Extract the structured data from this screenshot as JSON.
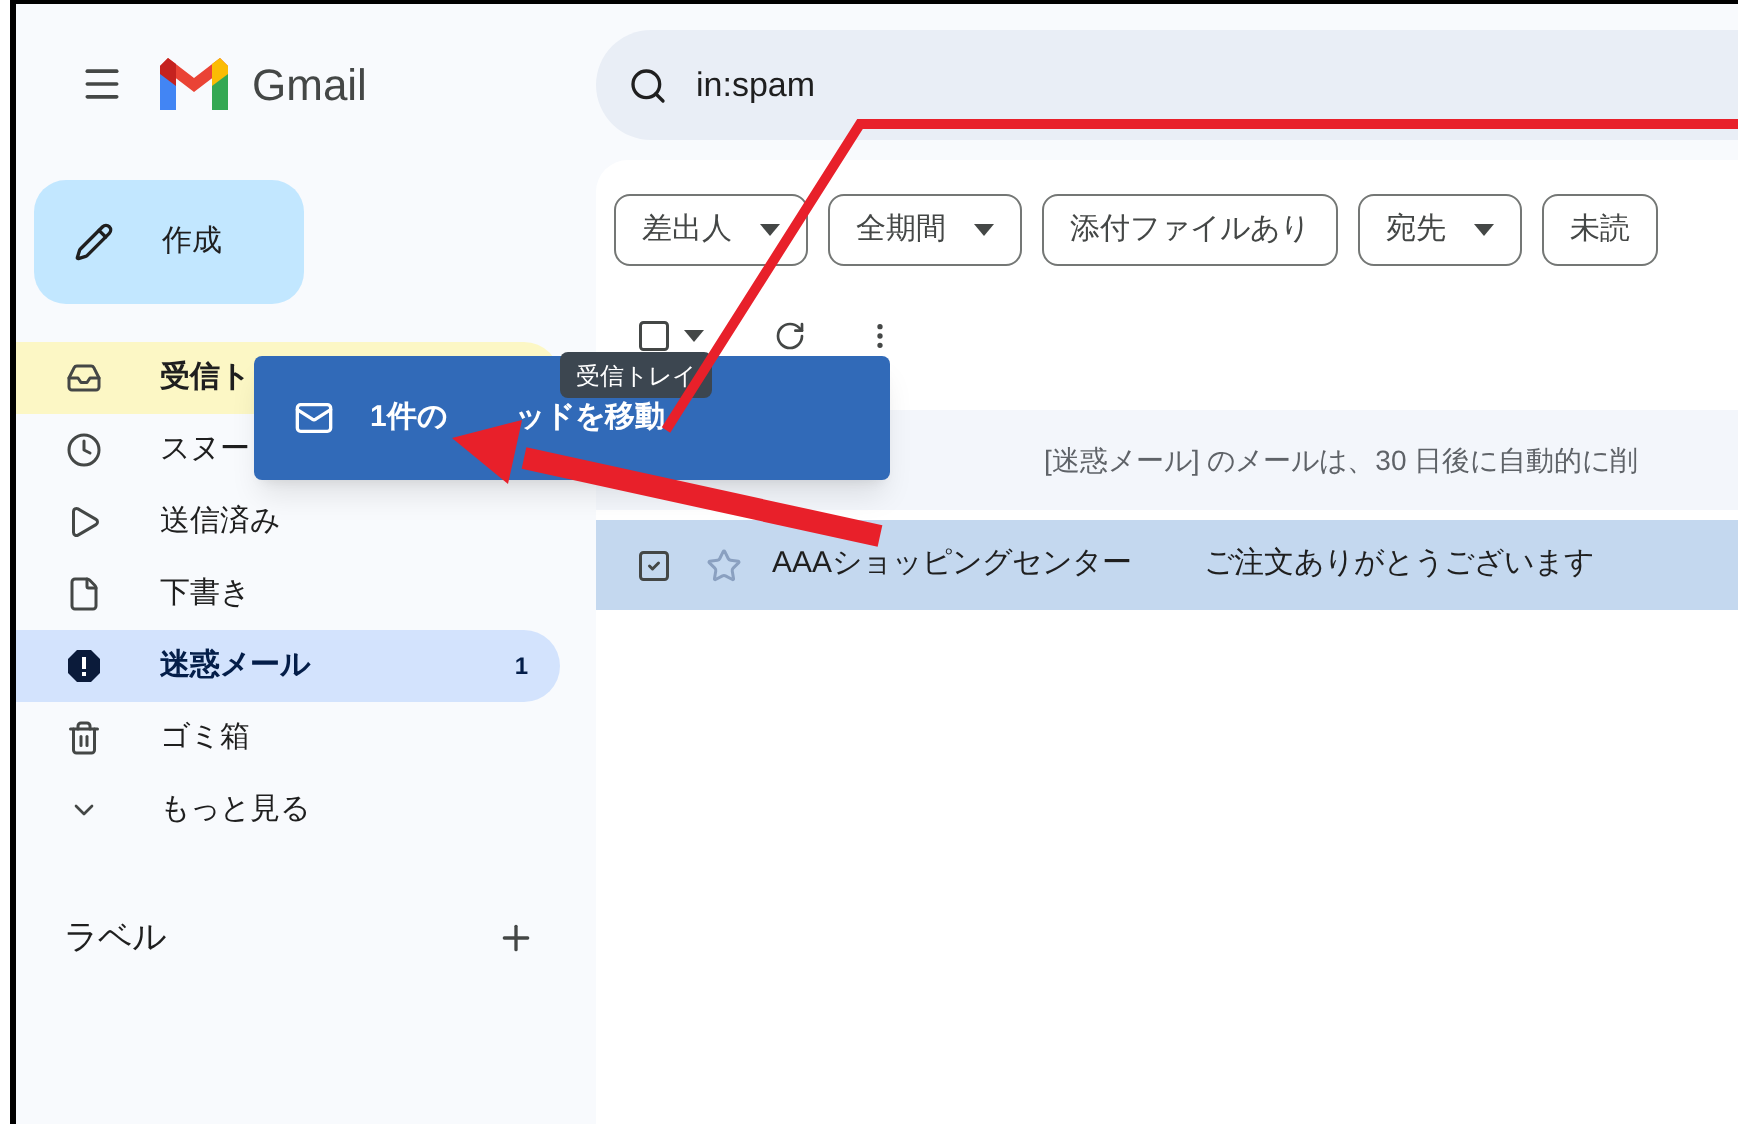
{
  "header": {
    "app_name": "Gmail",
    "search": {
      "value": "in:spam"
    }
  },
  "compose": {
    "label": "作成"
  },
  "nav": [
    {
      "label": "受信ト",
      "selected": false,
      "drop_highlight": true
    },
    {
      "label": "スヌー",
      "selected": false,
      "drop_highlight": false
    },
    {
      "label": "送信済み",
      "selected": false,
      "drop_highlight": false
    },
    {
      "label": "下書き",
      "selected": false,
      "drop_highlight": false
    },
    {
      "label": "迷惑メール",
      "selected": true,
      "drop_highlight": false,
      "count": "1"
    },
    {
      "label": "ゴミ箱",
      "selected": false,
      "drop_highlight": false
    },
    {
      "label": "もっと見る",
      "selected": false,
      "drop_highlight": false
    }
  ],
  "labels": {
    "title": "ラベル"
  },
  "filters": [
    {
      "label": "差出人",
      "dropdown": true
    },
    {
      "label": "全期間",
      "dropdown": true
    },
    {
      "label": "添付ファイルあり",
      "dropdown": false
    },
    {
      "label": "宛先",
      "dropdown": true
    },
    {
      "label": "未読",
      "dropdown": false
    }
  ],
  "toolbar": {
    "select_all_checked": false
  },
  "info_text": "[迷惑メール] のメールは、30 日後に自動的に削",
  "emails": [
    {
      "sender": "AAAショッピングセンター",
      "subject": "ご注文ありがとうございます",
      "checked": true,
      "starred": false,
      "selected": true
    }
  ],
  "drag_chip": {
    "text_parts": [
      "1件の",
      "ッドを移動"
    ]
  },
  "tooltip": {
    "text": "受信トレイ"
  }
}
